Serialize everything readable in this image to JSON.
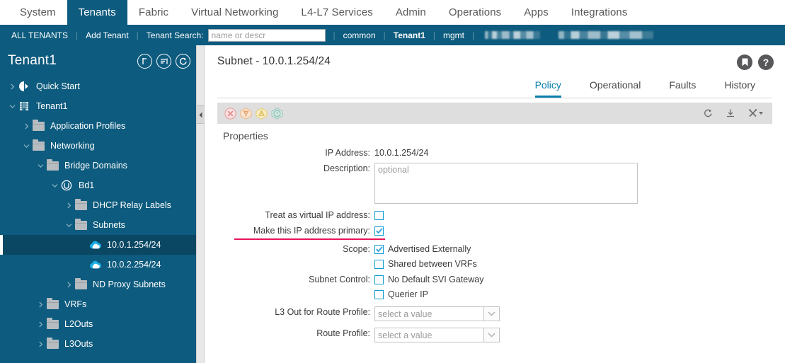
{
  "topnav": {
    "items": [
      {
        "label": "System",
        "active": false
      },
      {
        "label": "Tenants",
        "active": true
      },
      {
        "label": "Fabric",
        "active": false
      },
      {
        "label": "Virtual Networking",
        "active": false
      },
      {
        "label": "L4-L7 Services",
        "active": false
      },
      {
        "label": "Admin",
        "active": false
      },
      {
        "label": "Operations",
        "active": false
      },
      {
        "label": "Apps",
        "active": false
      },
      {
        "label": "Integrations",
        "active": false
      }
    ]
  },
  "subnav": {
    "all_tenants": "ALL TENANTS",
    "add_tenant": "Add Tenant",
    "search_label": "Tenant Search:",
    "search_placeholder": "name or descr",
    "search_value": "",
    "tenants": [
      "common",
      "Tenant1",
      "mgmt"
    ],
    "redacted_count": 2
  },
  "tree": {
    "title": "Tenant1",
    "header_buttons": [
      "expand-collapse-icon",
      "filter-list-icon",
      "refresh-icon"
    ],
    "items": [
      {
        "label": "Quick Start",
        "indent": 0,
        "twisty": "right",
        "icon": "quickstart-icon",
        "selected": false
      },
      {
        "label": "Tenant1",
        "indent": 0,
        "twisty": "down",
        "icon": "tenant-icon",
        "selected": false
      },
      {
        "label": "Application Profiles",
        "indent": 1,
        "twisty": "right",
        "icon": "folder-icon",
        "selected": false
      },
      {
        "label": "Networking",
        "indent": 1,
        "twisty": "down",
        "icon": "folder-icon",
        "selected": false
      },
      {
        "label": "Bridge Domains",
        "indent": 2,
        "twisty": "down",
        "icon": "folder-icon",
        "selected": false
      },
      {
        "label": "Bd1",
        "indent": 3,
        "twisty": "down",
        "icon": "bridge-domain-icon",
        "selected": false
      },
      {
        "label": "DHCP Relay Labels",
        "indent": 4,
        "twisty": "right",
        "icon": "folder-icon",
        "selected": false
      },
      {
        "label": "Subnets",
        "indent": 4,
        "twisty": "down",
        "icon": "folder-icon",
        "selected": false
      },
      {
        "label": "10.0.1.254/24",
        "indent": 5,
        "twisty": "none",
        "icon": "subnet-cloud-icon",
        "selected": true
      },
      {
        "label": "10.0.2.254/24",
        "indent": 5,
        "twisty": "none",
        "icon": "subnet-cloud-icon",
        "selected": false
      },
      {
        "label": "ND Proxy Subnets",
        "indent": 4,
        "twisty": "right",
        "icon": "folder-icon",
        "selected": false
      },
      {
        "label": "VRFs",
        "indent": 2,
        "twisty": "right",
        "icon": "folder-icon",
        "selected": false
      },
      {
        "label": "L2Outs",
        "indent": 2,
        "twisty": "right",
        "icon": "folder-icon",
        "selected": false
      },
      {
        "label": "L3Outs",
        "indent": 2,
        "twisty": "right",
        "icon": "folder-icon",
        "selected": false
      }
    ]
  },
  "content": {
    "page_title": "Subnet - 10.0.1.254/24",
    "head_icons": [
      "bookmark-icon",
      "help-icon"
    ],
    "tabs": [
      {
        "label": "Policy",
        "active": true
      },
      {
        "label": "Operational",
        "active": false
      },
      {
        "label": "Faults",
        "active": false
      },
      {
        "label": "History",
        "active": false
      }
    ],
    "faultbar": {
      "severities": [
        "critical",
        "major",
        "minor",
        "warning"
      ],
      "tools": [
        "refresh-icon",
        "download-icon",
        "actions-tools-icon"
      ]
    },
    "properties": {
      "section_title": "Properties",
      "ip_address_label": "IP Address:",
      "ip_address_value": "10.0.1.254/24",
      "description_label": "Description:",
      "description_placeholder": "optional",
      "description_value": "",
      "treat_virtual_label": "Treat as virtual IP address:",
      "treat_virtual_checked": false,
      "make_primary_label": "Make this IP address primary:",
      "make_primary_checked": true,
      "make_primary_highlight_color": "#e8145a",
      "scope_label": "Scope:",
      "scope_options": [
        {
          "label": "Advertised Externally",
          "checked": true
        },
        {
          "label": "Shared between VRFs",
          "checked": false
        }
      ],
      "subnet_control_label": "Subnet Control:",
      "subnet_control_options": [
        {
          "label": "No Default SVI Gateway",
          "checked": false
        },
        {
          "label": "Querier IP",
          "checked": false
        }
      ],
      "l3out_label": "L3 Out for Route Profile:",
      "l3out_value": "select a value",
      "route_profile_label": "Route Profile:",
      "route_profile_value": "select a value"
    }
  },
  "colors": {
    "brand_blue": "#0d5b7e",
    "selected_tree": "#0a4763",
    "accent_tab": "#0b7fae",
    "checkbox_blue": "#0c9bd6",
    "annotation_pink": "#e8145a",
    "faultbar_gray": "#dedede"
  }
}
